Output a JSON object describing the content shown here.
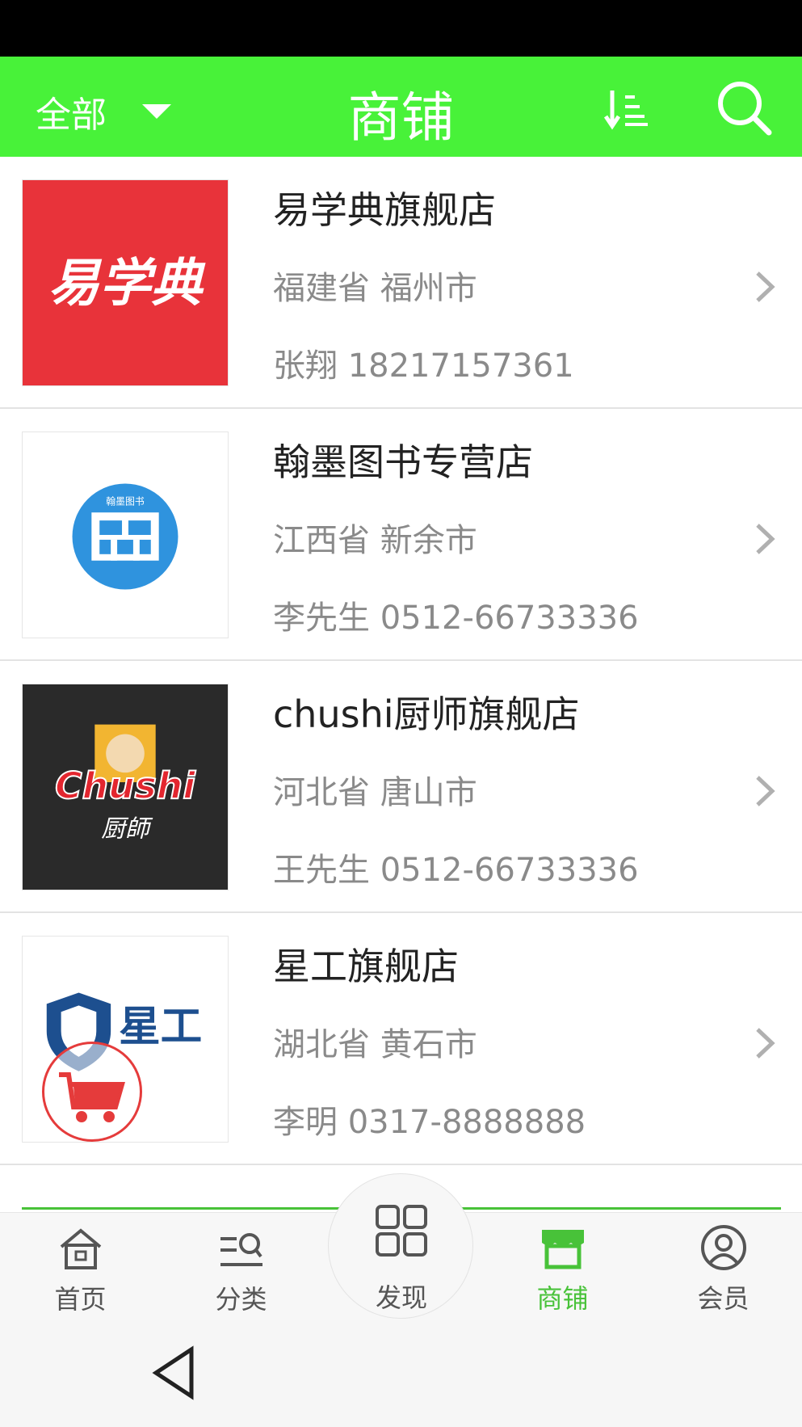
{
  "header": {
    "filter_label": "全部",
    "title": "商铺",
    "bg_color": "#48f239"
  },
  "shops": [
    {
      "name": "易学典旗舰店",
      "region": "福建省 福州市",
      "contact": "张翔 18217157361",
      "logo_text": "易学典",
      "logo_bg": "#e8333a"
    },
    {
      "name": "翰墨图书专营店",
      "region": "江西省 新余市",
      "contact": "李先生 0512-66733336",
      "logo_text": "翰墨图书",
      "logo_bg": "#ffffff"
    },
    {
      "name": "chushi厨师旗舰店",
      "region": "河北省 唐山市",
      "contact": "王先生 0512-66733336",
      "logo_text": "Chushi",
      "logo_sub": "厨師",
      "logo_bg": "#2a2a2a"
    },
    {
      "name": "星工旗舰店",
      "region": "湖北省 黄石市",
      "contact": "李明 0317-8888888",
      "logo_text": "星工",
      "logo_bg": "#ffffff"
    }
  ],
  "bottom_nav": {
    "items": [
      {
        "label": "首页",
        "icon": "home-icon"
      },
      {
        "label": "分类",
        "icon": "category-icon"
      },
      {
        "label": "发现",
        "icon": "grid-icon"
      },
      {
        "label": "商铺",
        "icon": "store-icon",
        "active": true
      },
      {
        "label": "会员",
        "icon": "user-icon"
      }
    ],
    "active_color": "#48c239"
  }
}
